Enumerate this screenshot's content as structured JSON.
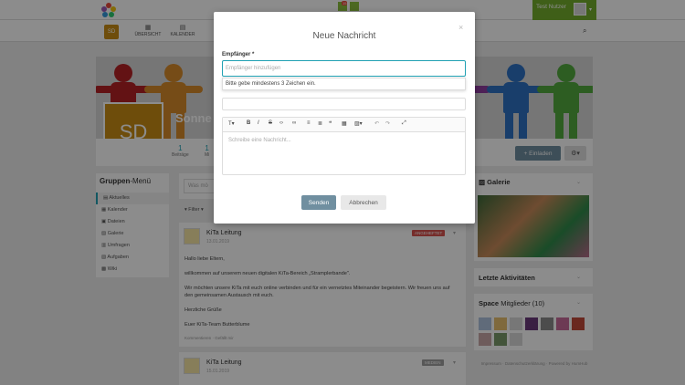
{
  "header": {
    "user_name": "Test Nutzer",
    "notification_count": "15",
    "nav": [
      {
        "label": "ÜBERSICHT",
        "icon": "dashboard-icon"
      },
      {
        "label": "KALENDER",
        "icon": "calendar-icon"
      }
    ],
    "space_initials": "SD"
  },
  "space": {
    "initials": "SD",
    "name_partial": "Sonne",
    "stats": [
      {
        "value": "1",
        "label": "Beiträge"
      },
      {
        "value": "1",
        "label": "Mi"
      }
    ],
    "invite_label": "Einladen",
    "banner_colors": [
      "#b52126",
      "#d88a2a",
      "#e7c431",
      "#2d8fce",
      "#2e71c4",
      "#53a93e"
    ]
  },
  "menu": {
    "title_bold": "Gruppen",
    "title_rest": "-Menü",
    "items": [
      {
        "label": "Aktuelles",
        "active": true
      },
      {
        "label": "Kalender",
        "active": false
      },
      {
        "label": "Dateien",
        "active": false
      },
      {
        "label": "Galerie",
        "active": false
      },
      {
        "label": "Umfragen",
        "active": false
      },
      {
        "label": "Aufgaben",
        "active": false
      },
      {
        "label": "Wiki",
        "active": false
      }
    ]
  },
  "feed": {
    "composer_placeholder": "Was mö",
    "filter_label": "Filter",
    "post1": {
      "author": "KiTa Leitung",
      "date": "13.01.2019",
      "badge": "ANGEHEFTET",
      "badge_color": "#d9534f",
      "lines": [
        "Hallo liebe Eltern,",
        "willkommen auf unserem neuen digitalen KiTa-Bereich „Stramplerbande\".",
        "Wir möchten unsere KiTa mit euch online verbinden und für ein vernetztes Miteinander begeistern. Wir freuen uns auf den gemeinsamen Austausch mit euch.",
        "Herzliche Grüße",
        "Euer KiTa-Team Butterblume"
      ],
      "actions": "Kommentieren · Gefällt mir"
    },
    "post2": {
      "author": "KiTa Leitung",
      "date": "15.01.2019",
      "badge": "MEDIEN",
      "badge_color": "#9e9e9e"
    }
  },
  "sidebar": {
    "gallery_title": "Galerie",
    "activities_title": "Letzte Aktivitäten",
    "members_title_bold": "Space",
    "members_title_rest": " Mitglieder (10)",
    "footer": "Impressum · Datenschutzerklärung · Powered by HumHub"
  },
  "modal": {
    "title": "Neue Nachricht",
    "recipient_label": "Empfänger *",
    "recipient_placeholder": "Empfänger hinzufügen",
    "hint": "Bitte gebe mindestens 3 Zeichen ein.",
    "editor_placeholder": "Schreibe eine Nachricht...",
    "send_label": "Senden",
    "cancel_label": "Abbrechen"
  }
}
